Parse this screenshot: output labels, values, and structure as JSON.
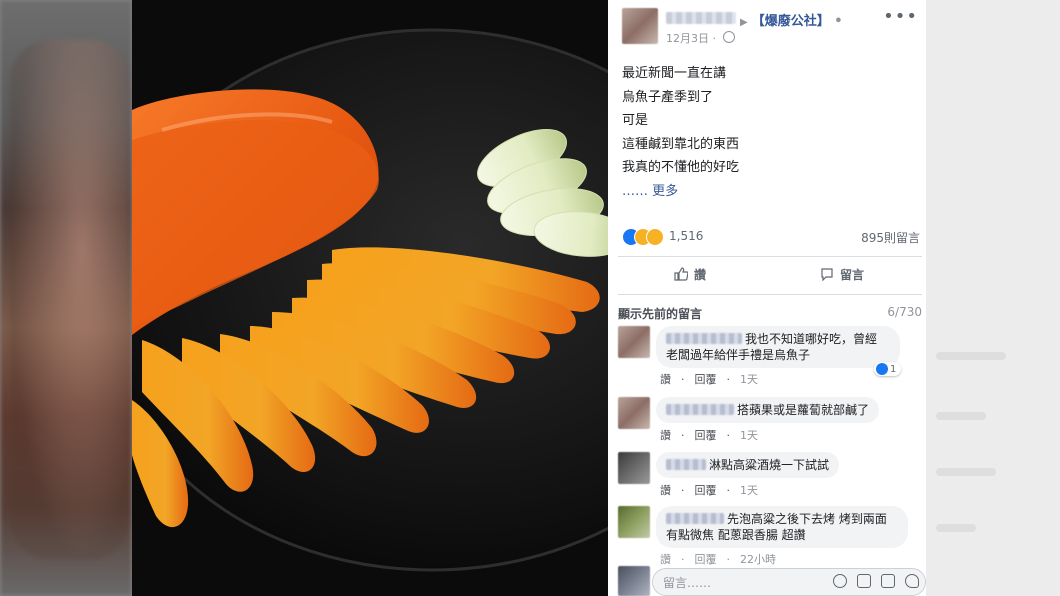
{
  "post": {
    "page_name": "【爆廢公社】",
    "date": "12月3日",
    "text_lines": [
      "最近新聞一直在講",
      "烏魚子產季到了",
      "可是",
      "這種鹹到靠北的東西",
      "我真的不懂他的好吃"
    ],
    "more_label": "…… 更多",
    "reaction_count": "1,516",
    "comment_count": "895則留言"
  },
  "actions": {
    "like_label": "讚",
    "comment_label": "留言"
  },
  "comments_header": {
    "previous_label": "顯示先前的留言",
    "count": "6/730"
  },
  "comments": [
    {
      "text_line1": "我也不知道哪好吃，曾經",
      "text_line2": "老闆過年給伴手禮是烏魚子",
      "like": "讚",
      "reply": "回覆",
      "time": "1天",
      "reactions": "1"
    },
    {
      "text_line1": "搭蘋果或是蘿蔔就部鹹了",
      "text_line2": "",
      "like": "讚",
      "reply": "回覆",
      "time": "1天",
      "reactions": ""
    },
    {
      "text_line1": "淋點高粱酒燒一下試試",
      "text_line2": "",
      "like": "讚",
      "reply": "回覆",
      "time": "1天",
      "reactions": ""
    },
    {
      "text_line1": "先泡高粱之後下去烤 烤到兩面",
      "text_line2": "有點微焦 配蔥跟香腸 超讚",
      "like": "讚",
      "reply": "回覆",
      "time": "22小時",
      "reactions": ""
    }
  ],
  "composer": {
    "placeholder": "留言……"
  },
  "colors": {
    "link": "#365899",
    "bubble": "#f2f3f5",
    "roe": "#e8590c",
    "like_blue": "#1877f2"
  },
  "icons": [
    "more-dots-icon",
    "globe-icon",
    "like-reaction-icon",
    "haha-reaction-icon",
    "wow-reaction-icon",
    "thumbs-up-icon",
    "comment-icon",
    "emoji-icon",
    "camera-icon",
    "gif-icon",
    "sticker-icon"
  ]
}
